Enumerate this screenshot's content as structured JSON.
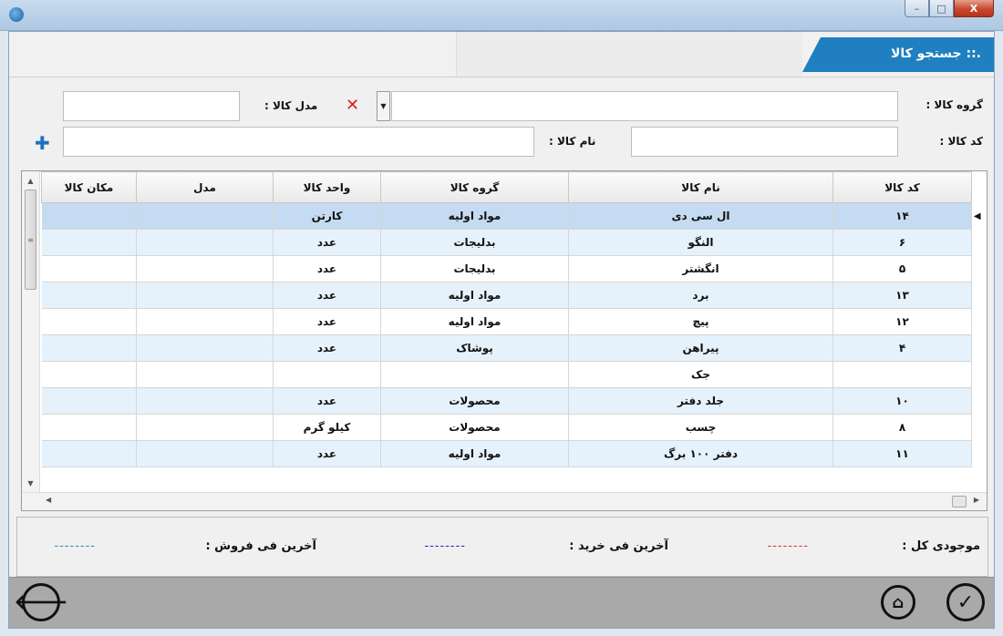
{
  "window": {
    "title": ".:: جستجو کالا",
    "controls": {
      "minimize": "–",
      "maximize": "□",
      "close": "X"
    }
  },
  "filters": {
    "group_label": "گروه کالا :",
    "group_value": "",
    "model_label": "مدل کالا :",
    "model_value": "",
    "code_label": "کد کالا :",
    "code_value": "",
    "name_label": "نام کالا :",
    "name_value": ""
  },
  "grid": {
    "columns": [
      "کد کالا",
      "نام کالا",
      "گروه کالا",
      "واحد کالا",
      "مدل",
      "مکان کالا"
    ],
    "rows": [
      {
        "code": "۱۴",
        "name": "ال سی دی",
        "group": "مواد اولیه",
        "unit": "کارتن",
        "model": "",
        "location": ""
      },
      {
        "code": "۶",
        "name": "النگو",
        "group": "بدلیجات",
        "unit": "عدد",
        "model": "",
        "location": ""
      },
      {
        "code": "۵",
        "name": "انگشتر",
        "group": "بدلیجات",
        "unit": "عدد",
        "model": "",
        "location": ""
      },
      {
        "code": "۱۳",
        "name": "برد",
        "group": "مواد اولیه",
        "unit": "عدد",
        "model": "",
        "location": ""
      },
      {
        "code": "۱۲",
        "name": "پیچ",
        "group": "مواد اولیه",
        "unit": "عدد",
        "model": "",
        "location": ""
      },
      {
        "code": "۴",
        "name": "پیراهن",
        "group": "پوشاک",
        "unit": "عدد",
        "model": "",
        "location": ""
      },
      {
        "code": "",
        "name": "جک",
        "group": "",
        "unit": "",
        "model": "",
        "location": ""
      },
      {
        "code": "۱۰",
        "name": "جلد دفتر",
        "group": "محصولات",
        "unit": "عدد",
        "model": "",
        "location": ""
      },
      {
        "code": "۸",
        "name": "چسب",
        "group": "محصولات",
        "unit": "کیلو گرم",
        "model": "",
        "location": ""
      },
      {
        "code": "۱۱",
        "name": "دفتر ۱۰۰ برگ",
        "group": "مواد اولیه",
        "unit": "عدد",
        "model": "",
        "location": ""
      }
    ]
  },
  "info": {
    "stock_label": "موجودی کل :",
    "stock_value": "--------",
    "last_buy_label": "آخرین فی خرید :",
    "last_buy_value": "--------",
    "last_sell_label": "آخرین فی فروش :",
    "last_sell_value": "--------",
    "colors": {
      "stock": "#d63a3a",
      "buy": "#2b2bb8",
      "sell": "#2a8fb0"
    }
  },
  "icons": {
    "back": "back-arrow-icon",
    "home": "home-icon",
    "confirm": "checkmark-icon",
    "clear": "close-x-icon",
    "add": "plus-icon"
  }
}
